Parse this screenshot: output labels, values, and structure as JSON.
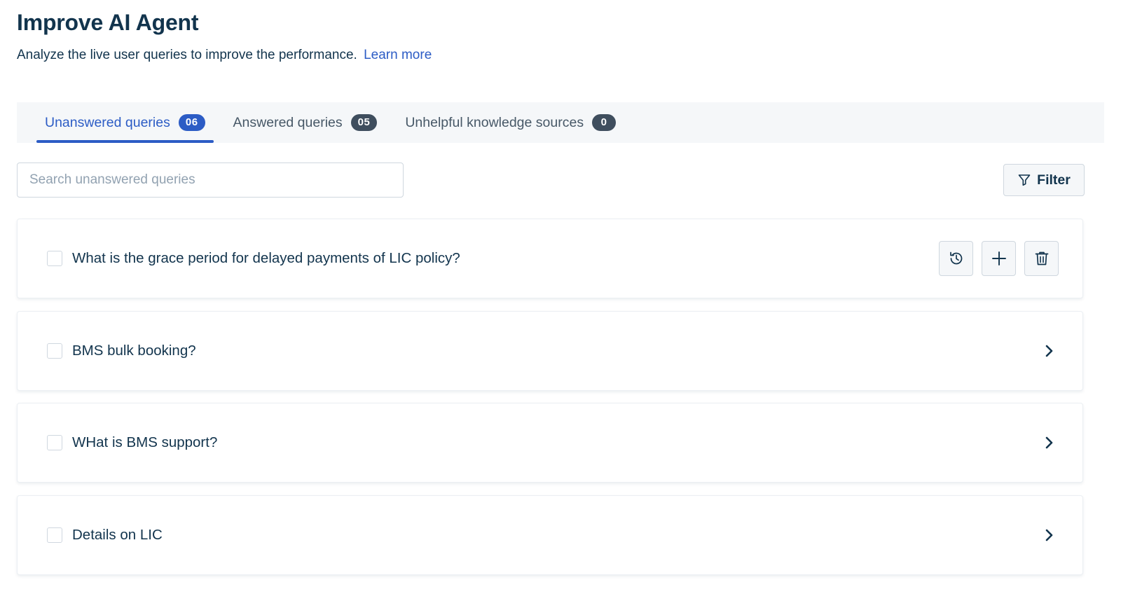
{
  "header": {
    "title": "Improve AI Agent",
    "description": "Analyze the live user queries to improve the performance.",
    "learn_more": "Learn more"
  },
  "tabs": [
    {
      "label": "Unanswered queries",
      "count": "06",
      "active": true
    },
    {
      "label": "Answered queries",
      "count": "05",
      "active": false
    },
    {
      "label": "Unhelpful knowledge sources",
      "count": "0",
      "active": false
    }
  ],
  "search": {
    "placeholder": "Search unanswered queries",
    "value": ""
  },
  "filter": {
    "label": "Filter",
    "icon": "filter-icon"
  },
  "queries": [
    {
      "text": "What is the grace period for delayed payments of LIC policy?",
      "expanded_actions": [
        "history-icon",
        "plus-icon",
        "trash-icon"
      ]
    },
    {
      "text": "BMS bulk booking?",
      "action": "chevron-right-icon"
    },
    {
      "text": "WHat is BMS support?",
      "action": "chevron-right-icon"
    },
    {
      "text": "Details on LIC",
      "action": "chevron-right-icon"
    }
  ],
  "colors": {
    "primary": "#2c5cc5",
    "text": "#12344d",
    "muted_text": "#475867",
    "badge_bg": "#3f4e5e",
    "tabbar_bg": "#f5f7f9",
    "border": "#cfd7df"
  }
}
